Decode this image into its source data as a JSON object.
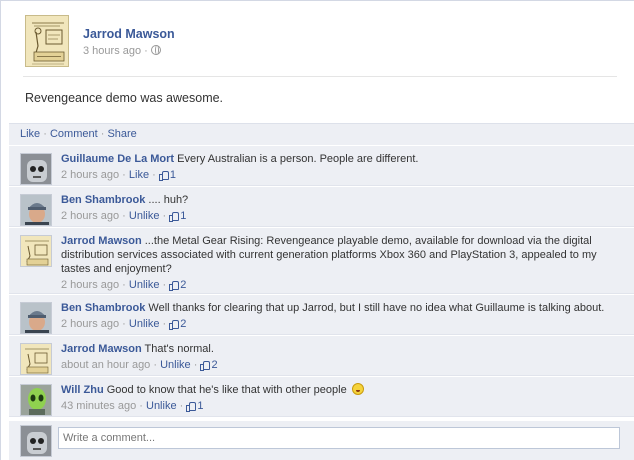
{
  "post": {
    "author": "Jarrod Mawson",
    "time": "3 hours ago",
    "separator": " · ",
    "privacy_icon": "globe-icon",
    "status": "Revengeance demo was awesome."
  },
  "actions": {
    "like": "Like",
    "comment": "Comment",
    "share": "Share",
    "separator": " · "
  },
  "comments": [
    {
      "author": "Guillaume De La Mort",
      "text": "Every Australian is a person. People are different.",
      "time": "2 hours ago",
      "action": "Like",
      "likes": "1",
      "avatar": "gray-robot-avatar"
    },
    {
      "author": "Ben Shambrook",
      "text": ".... huh?",
      "time": "2 hours ago",
      "action": "Unlike",
      "likes": "1",
      "avatar": "beanie-person-avatar"
    },
    {
      "author": "Jarrod Mawson",
      "text": "...the Metal Gear Rising: Revengeance playable demo, available for download via the digital distribution services associated with current generation platforms Xbox 360 and PlayStation 3, appealed to my tastes and enjoyment?",
      "time": "2 hours ago",
      "action": "Unlike",
      "likes": "2",
      "avatar": "sketch-avatar"
    },
    {
      "author": "Ben Shambrook",
      "text": "Well thanks for clearing that up Jarrod, but I still have no idea what Guillaume is talking about.",
      "time": "2 hours ago",
      "action": "Unlike",
      "likes": "2",
      "avatar": "beanie-person-avatar"
    },
    {
      "author": "Jarrod Mawson",
      "text": "That's normal.",
      "time": "about an hour ago",
      "action": "Unlike",
      "likes": "2",
      "avatar": "sketch-avatar"
    },
    {
      "author": "Will Zhu",
      "text": "Good to know that he's like that with other people",
      "time": "43 minutes ago",
      "action": "Unlike",
      "likes": "1",
      "avatar": "green-alien-avatar",
      "emoticon": "tongue-smiley-icon"
    }
  ],
  "write_comment": {
    "placeholder": "Write a comment...",
    "avatar": "gray-robot-avatar"
  },
  "colors": {
    "link": "#3b5998",
    "comment_bg": "#edeff4",
    "meta": "#999999"
  }
}
